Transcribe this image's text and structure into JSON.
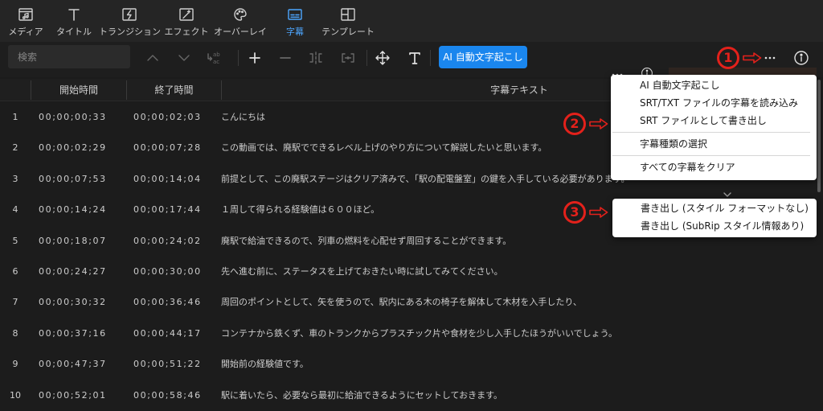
{
  "tabs": [
    {
      "label": "メディア",
      "icon": "media-icon",
      "active": false
    },
    {
      "label": "タイトル",
      "icon": "title-icon",
      "active": false
    },
    {
      "label": "トランジション",
      "icon": "transition-icon",
      "active": false
    },
    {
      "label": "エフェクト",
      "icon": "effect-icon",
      "active": false
    },
    {
      "label": "オーバーレイ",
      "icon": "overlay-icon",
      "active": false
    },
    {
      "label": "字幕",
      "icon": "subtitle-icon",
      "active": true
    },
    {
      "label": "テンプレート",
      "icon": "template-icon",
      "active": false
    }
  ],
  "toolbar": {
    "search_placeholder": "検索",
    "icons": [
      "chevron-up-icon",
      "chevron-down-icon",
      "replace-icon",
      "plus-icon",
      "minus-icon",
      "split-icon",
      "merge-icon",
      "move-icon",
      "text-style-icon",
      "more-icon",
      "info-icon"
    ],
    "replace_icon": {
      "top": "ab",
      "bottom": "ac"
    },
    "ai_button_label": "AI 自動文字起こし"
  },
  "table": {
    "headers": {
      "start": "開始時間",
      "end": "終了時間",
      "text": "字幕テキスト"
    },
    "rows": [
      {
        "index": "1",
        "start": "00;00;00;33",
        "end": "00;00;02;03",
        "text": "こんにちは"
      },
      {
        "index": "2",
        "start": "00;00;02;29",
        "end": "00;00;07;28",
        "text": "この動画では、廃駅でできるレベル上げのやり方について解説したいと思います。"
      },
      {
        "index": "3",
        "start": "00;00;07;53",
        "end": "00;00;14;04",
        "text": "前提として、この廃駅ステージはクリア済みで、「駅の配電盤室」の鍵を入手している必要があります。"
      },
      {
        "index": "4",
        "start": "00;00;14;24",
        "end": "00;00;17;44",
        "text": "１周して得られる経験値は６００ほど。"
      },
      {
        "index": "5",
        "start": "00;00;18;07",
        "end": "00;00;24;02",
        "text": "廃駅で給油できるので、列車の燃料を心配せず周回することができます。"
      },
      {
        "index": "6",
        "start": "00;00;24;27",
        "end": "00;00;30;00",
        "text": "先へ進む前に、ステータスを上げておきたい時に試してみてください。"
      },
      {
        "index": "7",
        "start": "00;00;30;32",
        "end": "00;00;36;46",
        "text": "周回のポイントとして、矢を使うので、駅内にある木の椅子を解体して木材を入手したり、"
      },
      {
        "index": "8",
        "start": "00;00;37;16",
        "end": "00;00;44;17",
        "text": "コンテナから鉄くず、車のトランクからプラスチック片や食材を少し入手したほうがいいでしょう。"
      },
      {
        "index": "9",
        "start": "00;00;47;37",
        "end": "00;00;51;22",
        "text": "開始前の経験値です。"
      },
      {
        "index": "10",
        "start": "00;00;52;01",
        "end": "00;00;58;46",
        "text": "駅に着いたら、必要なら最初に給油できるようにセットしておきます。"
      }
    ]
  },
  "context_menu": {
    "groups": [
      [
        "AI 自動文字起こし",
        "SRT/TXT ファイルの字幕を読み込み",
        "SRT ファイルとして書き出し"
      ],
      [
        "字幕種類の選択"
      ],
      [
        "すべての字幕をクリア"
      ]
    ]
  },
  "export_submenu": {
    "items": [
      "書き出し (スタイル フォーマットなし)",
      "書き出し (SubRip スタイル情報あり)"
    ]
  },
  "annotations": [
    {
      "number": "1",
      "icon": "arrow-right-icon"
    },
    {
      "number": "2",
      "icon": "arrow-right-icon"
    },
    {
      "number": "3",
      "icon": "arrow-right-icon"
    }
  ],
  "colors": {
    "accent": "#4da6ff",
    "ai_button": "#1a86ee",
    "annotation": "#e3211b",
    "menu_background": "#ffffff"
  }
}
